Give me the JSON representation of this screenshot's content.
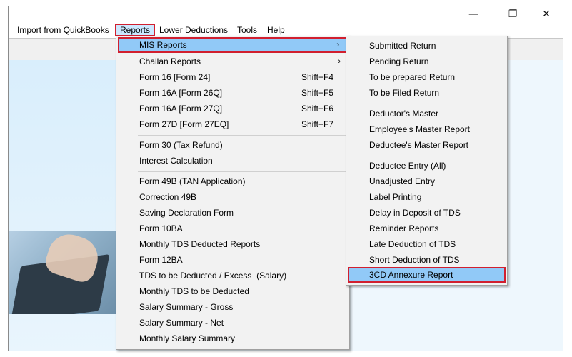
{
  "window": {
    "minimize_glyph": "—",
    "maximize_glyph": "❐",
    "close_glyph": "✕"
  },
  "menubar": {
    "items": [
      {
        "label": "Import from QuickBooks"
      },
      {
        "label": "Reports"
      },
      {
        "label": "Lower Deductions"
      },
      {
        "label": "Tools"
      },
      {
        "label": "Help"
      }
    ]
  },
  "reports_menu": {
    "items": [
      {
        "label": "MIS Reports",
        "submenu": "›"
      },
      {
        "label": "Challan Reports",
        "submenu": "›"
      },
      {
        "label": "Form 16 [Form 24]",
        "shortcut": "Shift+F4"
      },
      {
        "label": "Form 16A [Form 26Q]",
        "shortcut": "Shift+F5"
      },
      {
        "label": "Form 16A [Form 27Q]",
        "shortcut": "Shift+F6"
      },
      {
        "label": "Form 27D [Form 27EQ]",
        "shortcut": "Shift+F7"
      },
      {
        "label": "Form 30 (Tax Refund)"
      },
      {
        "label": "Interest Calculation"
      },
      {
        "label": "Form 49B (TAN Application)"
      },
      {
        "label": "Correction 49B"
      },
      {
        "label": "Saving Declaration Form"
      },
      {
        "label": "Form 10BA"
      },
      {
        "label": "Monthly TDS Deducted Reports"
      },
      {
        "label": "Form 12BA"
      },
      {
        "label": "TDS to be Deducted / Excess  (Salary)"
      },
      {
        "label": "Monthly TDS to be Deducted"
      },
      {
        "label": "Salary Summary - Gross"
      },
      {
        "label": "Salary Summary - Net"
      },
      {
        "label": "Monthly Salary Summary"
      }
    ]
  },
  "mis_submenu": {
    "items": [
      {
        "label": "Submitted Return"
      },
      {
        "label": "Pending Return"
      },
      {
        "label": "To be prepared Return"
      },
      {
        "label": "To be Filed Return"
      },
      {
        "label": "Deductor's Master"
      },
      {
        "label": "Employee's Master Report"
      },
      {
        "label": "Deductee's Master Report"
      },
      {
        "label": "Deductee Entry (All)"
      },
      {
        "label": "Unadjusted Entry"
      },
      {
        "label": "Label Printing"
      },
      {
        "label": "Delay in Deposit of TDS"
      },
      {
        "label": "Reminder Reports"
      },
      {
        "label": "Late Deduction of TDS"
      },
      {
        "label": "Short Deduction of TDS"
      },
      {
        "label": "3CD Annexure Report"
      }
    ]
  },
  "colors": {
    "highlight_border": "#d11f2f",
    "highlight_fill": "#91c9f7",
    "menu_background": "#f2f2f2"
  }
}
